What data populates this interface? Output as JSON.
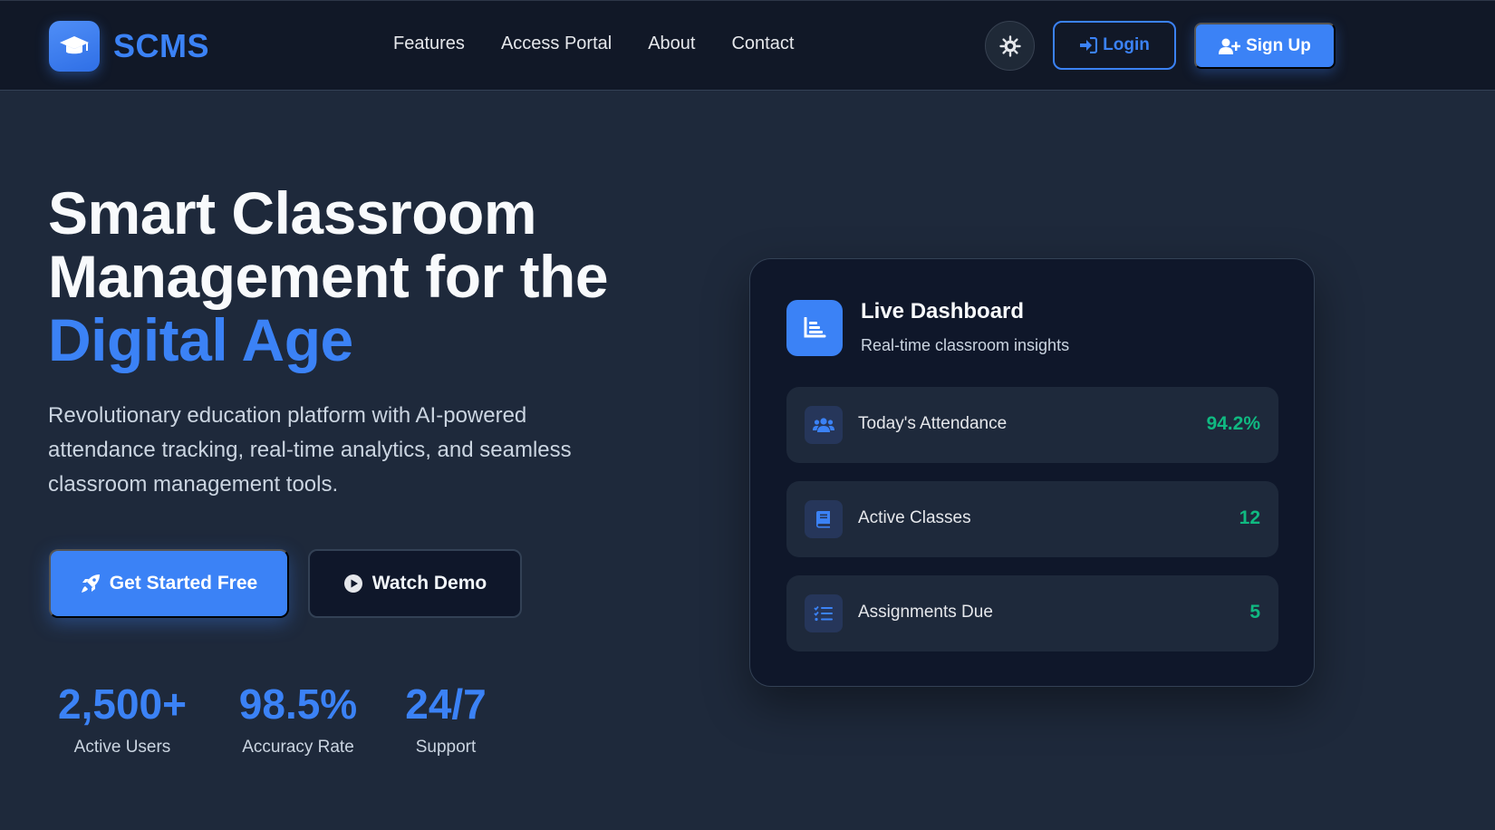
{
  "brand": {
    "name": "SCMS",
    "logo_icon": "graduation-cap-icon"
  },
  "nav": {
    "links": [
      "Features",
      "Access Portal",
      "About",
      "Contact"
    ],
    "theme_icon": "sun-icon",
    "login_label": "Login",
    "signup_label": "Sign Up"
  },
  "hero": {
    "title_line1": "Smart Classroom",
    "title_line2": "Management for the",
    "title_accent": "Digital Age",
    "description": "Revolutionary education platform with AI-powered attendance tracking, real-time analytics, and seamless classroom management tools.",
    "cta_primary": "Get Started Free",
    "cta_secondary": "Watch Demo",
    "stats": [
      {
        "value": "2,500+",
        "label": "Active Users"
      },
      {
        "value": "98.5%",
        "label": "Accuracy Rate"
      },
      {
        "value": "24/7",
        "label": "Support"
      }
    ]
  },
  "dashboard": {
    "title": "Live Dashboard",
    "subtitle": "Real-time classroom insights",
    "metrics": [
      {
        "label": "Today's Attendance",
        "value": "94.2%",
        "icon": "users-icon"
      },
      {
        "label": "Active Classes",
        "value": "12",
        "icon": "book-icon"
      },
      {
        "label": "Assignments Due",
        "value": "5",
        "icon": "tasks-list-icon"
      }
    ]
  },
  "colors": {
    "accent": "#3b82f6",
    "success": "#10b981",
    "background": "#1e293b",
    "navbar": "#111827",
    "card": "#0f172a"
  }
}
